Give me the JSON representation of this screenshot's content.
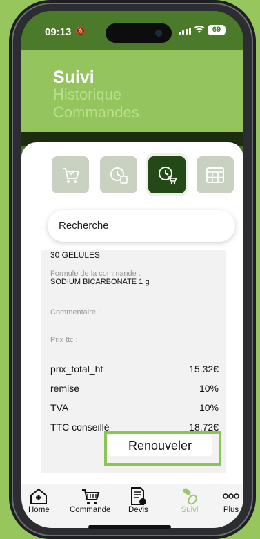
{
  "status": {
    "time": "09:13",
    "battery": "69"
  },
  "header": {
    "title": "Suivi",
    "subtitle_line1": "Historique",
    "subtitle_line2": "Commandes"
  },
  "tabs": [
    {
      "icon": "cart-check-icon",
      "active": false
    },
    {
      "icon": "clock-document-icon",
      "active": false
    },
    {
      "icon": "clock-cart-icon",
      "active": true
    },
    {
      "icon": "calendar-icon",
      "active": false
    }
  ],
  "search": {
    "placeholder": "Recherche"
  },
  "order": {
    "quantity": "30 GELULES",
    "formula_label": "Formule de la commande :",
    "formula_value": "SODIUM BICARBONATE 1 g",
    "comment_label": "Commentaire :",
    "price_label": "Prix ttc :",
    "rows": [
      {
        "label": "prix_total_ht",
        "value": "15.32€"
      },
      {
        "label": "remise",
        "value": "10%"
      },
      {
        "label": "TVA",
        "value": "10%"
      },
      {
        "label": "TTC conseillé",
        "value": "18.72€"
      }
    ],
    "renew_button": "Renouveler"
  },
  "nav": [
    {
      "label": "Home",
      "icon": "home-plus-icon"
    },
    {
      "label": "Commande",
      "icon": "cart-icon"
    },
    {
      "label": "Devis",
      "icon": "document-icon"
    },
    {
      "label": "Suivi",
      "icon": "pills-icon"
    },
    {
      "label": "Plus",
      "icon": "more-icon"
    }
  ],
  "colors": {
    "background": "#97c65c",
    "header_green": "#93c45d",
    "accent_dark": "#234a16",
    "nav_active": "#9ac96c"
  }
}
